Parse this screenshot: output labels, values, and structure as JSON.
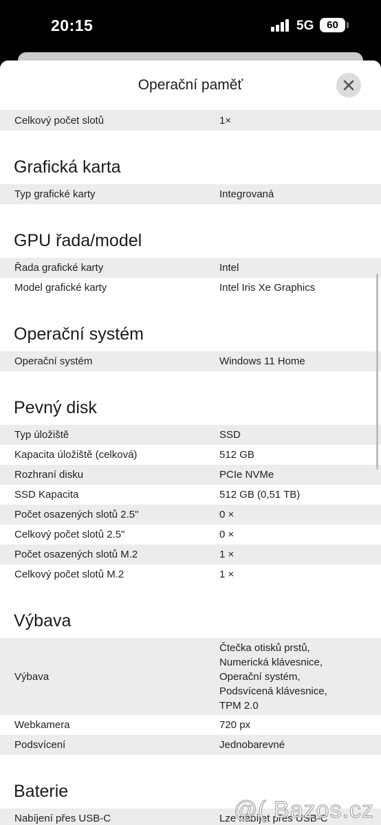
{
  "status_bar": {
    "time": "20:15",
    "network": "5G",
    "battery": "60"
  },
  "sheet": {
    "title": "Operační paměť"
  },
  "top_row": {
    "label": "Celkový počet slotů",
    "value": "1×"
  },
  "sections": [
    {
      "title": "Grafická karta",
      "rows": [
        {
          "label": "Typ grafické karty",
          "value": "Integrovaná"
        }
      ]
    },
    {
      "title": "GPU řada/model",
      "rows": [
        {
          "label": "Řada grafické karty",
          "value": "Intel"
        },
        {
          "label": "Model grafické karty",
          "value": "Intel Iris Xe Graphics"
        }
      ]
    },
    {
      "title": "Operační systém",
      "rows": [
        {
          "label": "Operační systém",
          "value": "Windows 11 Home"
        }
      ]
    },
    {
      "title": "Pevný disk",
      "rows": [
        {
          "label": "Typ úložiště",
          "value": "SSD"
        },
        {
          "label": "Kapacita úložiště (celková)",
          "value": "512 GB"
        },
        {
          "label": "Rozhraní disku",
          "value": "PCIe NVMe"
        },
        {
          "label": "SSD Kapacita",
          "value": "512 GB (0,51 TB)"
        },
        {
          "label": "Počet osazených slotů 2.5\"",
          "value": "0 ×"
        },
        {
          "label": "Celkový počet slotů 2.5\"",
          "value": "0 ×"
        },
        {
          "label": "Počet osazených slotů M.2",
          "value": "1 ×"
        },
        {
          "label": "Celkový počet slotů M.2",
          "value": "1 ×"
        }
      ]
    },
    {
      "title": "Výbava",
      "rows": [
        {
          "label": "Výbava",
          "value_lines": [
            "Čtečka otisků prstů,",
            "Numerická klávesnice,",
            "Operační systém,",
            "Podsvícená klávesnice,",
            "TPM 2.0"
          ]
        },
        {
          "label": "Webkamera",
          "value": "720 px"
        },
        {
          "label": "Podsvícení",
          "value": "Jednobarevné"
        }
      ]
    },
    {
      "title": "Baterie",
      "rows": [
        {
          "label": "Nabíjení přes USB-C",
          "value": "Lze nabíjet přes USB-C"
        }
      ]
    }
  ],
  "watermark": "@( Bazos.cz",
  "colors": {
    "row_gray": "#ececec",
    "sheet_bg": "#ffffff",
    "status_bg": "#000000"
  }
}
